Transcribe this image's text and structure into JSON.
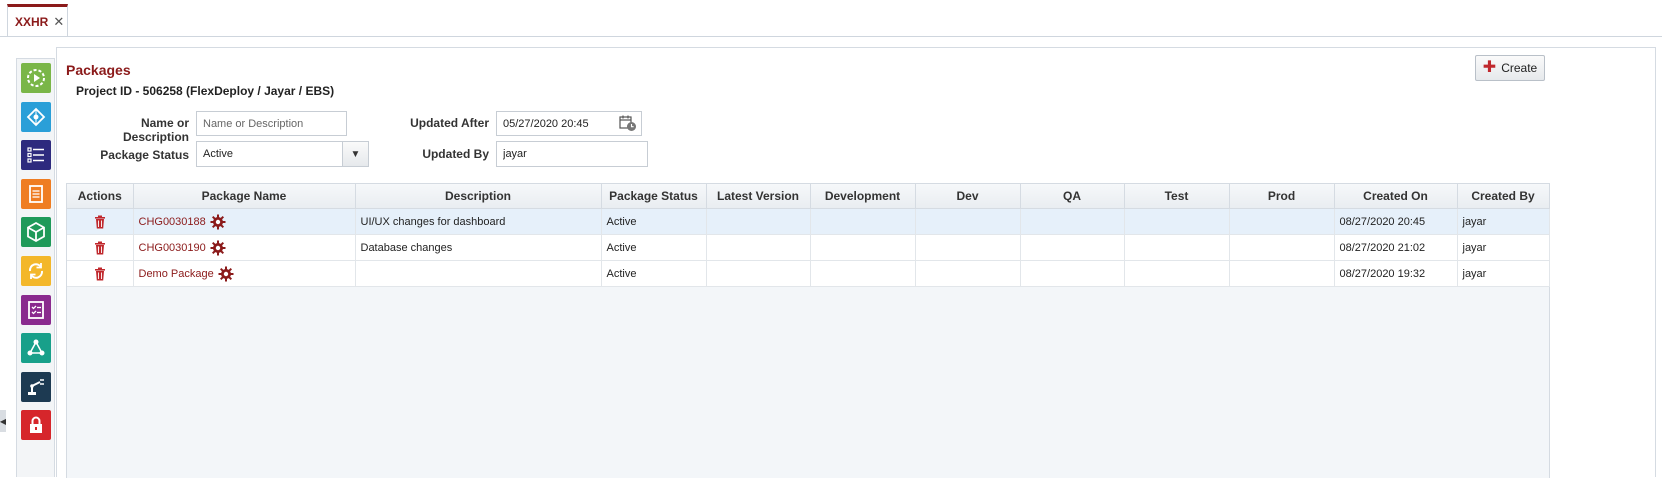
{
  "tab": {
    "label": "XXHR",
    "close": "✕"
  },
  "rail": [
    {
      "icon": "play-gear-icon",
      "color": "#7ab648"
    },
    {
      "icon": "network-icon",
      "color": "#2a9fd8"
    },
    {
      "icon": "task-list-icon",
      "color": "#2d2a7e"
    },
    {
      "icon": "document-icon",
      "color": "#ef7d22"
    },
    {
      "icon": "package-box-icon",
      "color": "#1f9a59"
    },
    {
      "icon": "sync-icon",
      "color": "#f3b72a"
    },
    {
      "icon": "checklist-icon",
      "color": "#8a2a8e"
    },
    {
      "icon": "share-nodes-icon",
      "color": "#18a08a"
    },
    {
      "icon": "robot-arm-icon",
      "color": "#1d3a52"
    },
    {
      "icon": "lock-icon",
      "color": "#d6262b"
    }
  ],
  "page": {
    "title": "Packages",
    "subtitle": "Project ID - 506258 (FlexDeploy / Jayar / EBS)",
    "create_label": "Create"
  },
  "filters": {
    "name_label": "Name or Description",
    "name_placeholder": "Name or Description",
    "status_label": "Package Status",
    "status_value": "Active",
    "updated_after_label": "Updated After",
    "updated_after_value": "05/27/2020 20:45",
    "updated_by_label": "Updated By",
    "updated_by_value": "jayar"
  },
  "table": {
    "columns": [
      "Actions",
      "Package Name",
      "Description",
      "Package Status",
      "Latest Version",
      "Development",
      "Dev",
      "QA",
      "Test",
      "Prod",
      "Created On",
      "Created By"
    ],
    "rows": [
      {
        "name": "CHG0030188",
        "description": "UI/UX changes for dashboard",
        "status": "Active",
        "latest_version": "",
        "development": "",
        "dev": "",
        "qa": "",
        "test": "",
        "prod": "",
        "created_on": "08/27/2020 20:45",
        "created_by": "jayar",
        "selected": true
      },
      {
        "name": "CHG0030190",
        "description": "Database changes",
        "status": "Active",
        "latest_version": "",
        "development": "",
        "dev": "",
        "qa": "",
        "test": "",
        "prod": "",
        "created_on": "08/27/2020 21:02",
        "created_by": "jayar",
        "selected": false
      },
      {
        "name": "Demo Package",
        "description": "",
        "status": "Active",
        "latest_version": "",
        "development": "",
        "dev": "",
        "qa": "",
        "test": "",
        "prod": "",
        "created_on": "08/27/2020 19:32",
        "created_by": "jayar",
        "selected": false
      }
    ]
  },
  "colors": {
    "accent": "#8b1a1a",
    "selected_row": "#e6f0fa",
    "create_plus": "#c0282d"
  }
}
